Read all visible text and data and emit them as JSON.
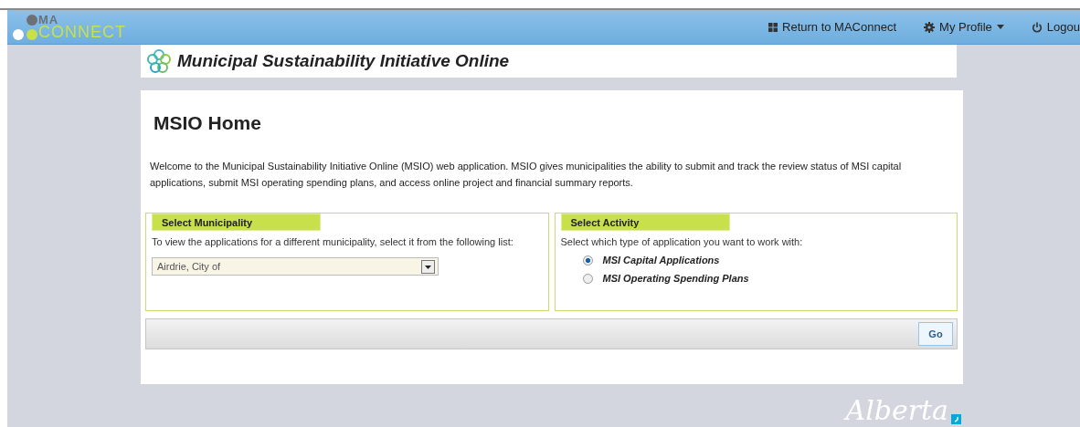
{
  "header": {
    "logo_top": "MA",
    "logo_bottom": "CONNECT",
    "nav": [
      {
        "kind": "grid",
        "label": "Return to MAConnect",
        "dropdown": false
      },
      {
        "kind": "gear",
        "label": "My Profile",
        "dropdown": true
      },
      {
        "kind": "power",
        "label": "Logou",
        "dropdown": false
      }
    ]
  },
  "app_title": "Municipal Sustainability Initiative Online",
  "page": {
    "heading": "MSIO Home",
    "intro": "Welcome to the Municipal Sustainability Initiative Online (MSIO) web application. MSIO gives municipalities the ability to submit and track the review status of MSI capital applications, submit MSI operating spending plans, and access online project and financial summary reports.",
    "municipality": {
      "legend": "Select Municipality",
      "prompt": "To view the applications for a different municipality, select it from the following list:",
      "value": "Airdrie, City of"
    },
    "activity": {
      "legend": "Select Activity",
      "prompt": "Select which type of application you want to work with:",
      "options": [
        {
          "label": "MSI Capital Applications",
          "selected": true
        },
        {
          "label": "MSI Operating Spending Plans",
          "selected": false
        }
      ]
    },
    "button": "Go"
  },
  "footer_logo": "Alberta"
}
